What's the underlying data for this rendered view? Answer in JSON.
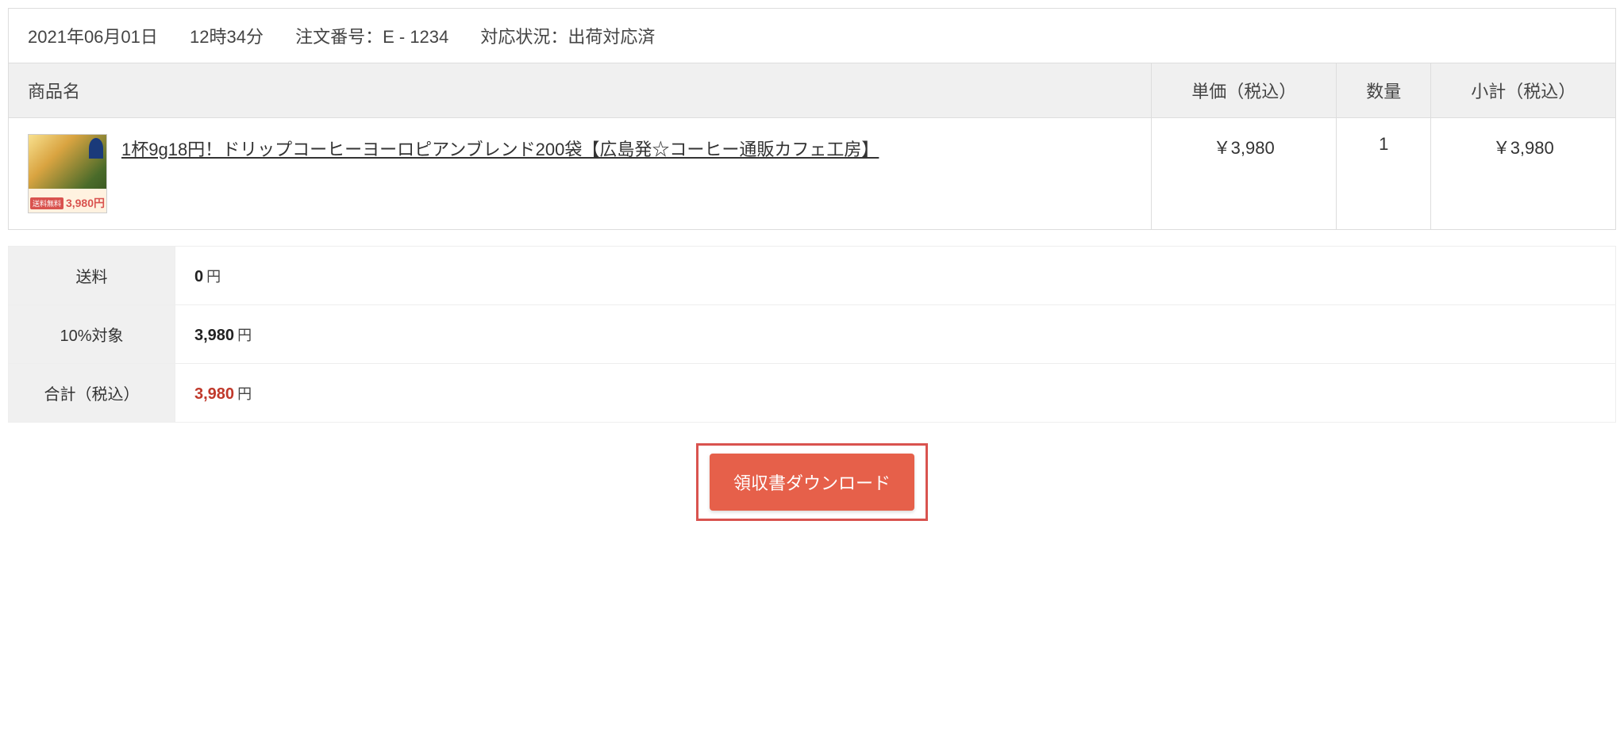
{
  "order": {
    "date": "2021年06月01日",
    "time": "12時34分",
    "order_number_label": "注文番号：E - 1234",
    "status_label": "対応状況：出荷対応済"
  },
  "columns": {
    "product": "商品名",
    "unit_price": "単価（税込）",
    "quantity": "数量",
    "subtotal": "小計（税込）"
  },
  "item": {
    "name": "1杯9g18円！ドリップコーヒーヨーロピアンブレンド200袋【広島発☆コーヒー通販カフェ工房】",
    "unit_price": "￥3,980",
    "quantity": "1",
    "subtotal": "￥3,980",
    "thumb_badge": "送料無料"
  },
  "summary": {
    "shipping_label": "送料",
    "shipping_value": "0",
    "tax10_label": "10%対象",
    "tax10_value": "3,980",
    "total_label": "合計（税込）",
    "total_value": "3,980",
    "unit": "円"
  },
  "button": {
    "download_receipt": "領収書ダウンロード"
  }
}
